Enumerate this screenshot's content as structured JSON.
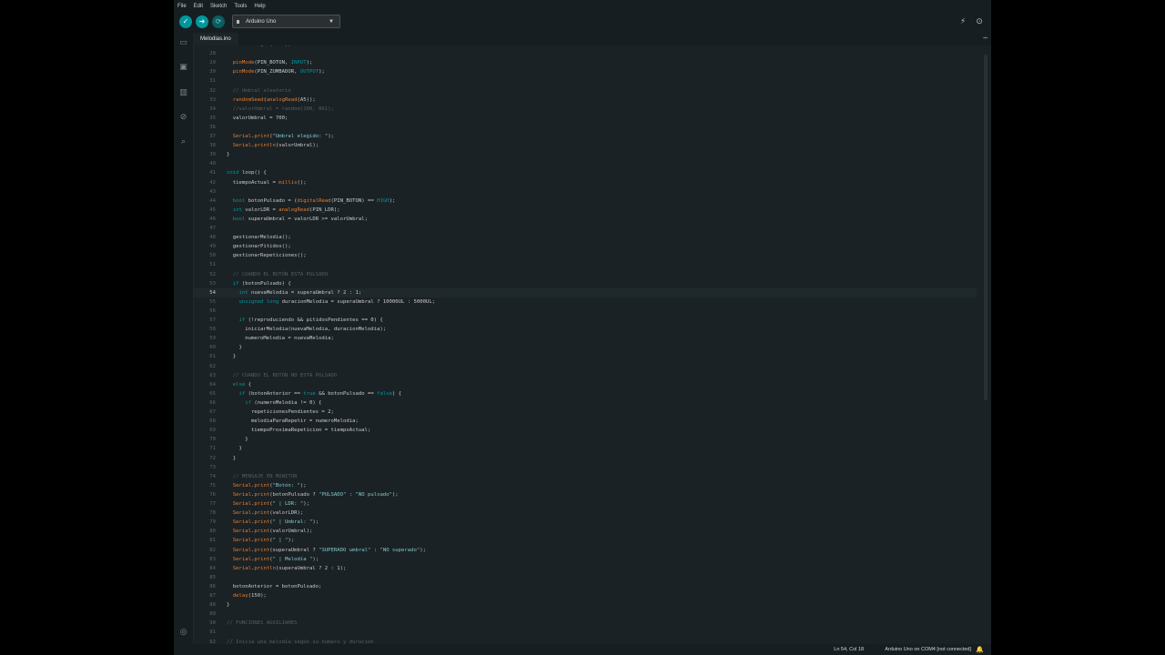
{
  "menu": [
    "File",
    "Edit",
    "Sketch",
    "Tools",
    "Help"
  ],
  "toolbar": {
    "verify_icon": "check-icon",
    "upload_icon": "arrow-right-icon",
    "debug_icon": "debug-icon",
    "board_name": "Arduino Uno",
    "serial_plotter_icon": "plotter-icon",
    "serial_monitor_icon": "magnifier-icon"
  },
  "tab": {
    "filename": "Melodias.ino",
    "more": "⋯"
  },
  "sidebar": [
    "folder-icon",
    "board-icon",
    "library-icon",
    "debug-icon",
    "search-icon",
    "user-icon"
  ],
  "editor": {
    "current_line": 54,
    "lines": [
      {
        "n": "27",
        "t": "  Serial.begin(9600);"
      },
      {
        "n": "28",
        "t": ""
      },
      {
        "n": "29",
        "t": "  pinMode(PIN_BOTON, INPUT);"
      },
      {
        "n": "30",
        "t": "  pinMode(PIN_ZUMBADOR, OUTPUT);"
      },
      {
        "n": "31",
        "t": ""
      },
      {
        "n": "32",
        "t": "  // Umbral aleatorio"
      },
      {
        "n": "33",
        "t": "  randomSeed(analogRead(A5));"
      },
      {
        "n": "34",
        "t": "  //valorUmbral = random(200, 801);"
      },
      {
        "n": "35",
        "t": "  valorUmbral = 700;"
      },
      {
        "n": "36",
        "t": ""
      },
      {
        "n": "37",
        "t": "  Serial.print(\"Umbral elegido: \");"
      },
      {
        "n": "38",
        "t": "  Serial.println(valorUmbral);"
      },
      {
        "n": "39",
        "t": "}"
      },
      {
        "n": "40",
        "t": ""
      },
      {
        "n": "41",
        "t": "void loop() {"
      },
      {
        "n": "42",
        "t": "  tiempoActual = millis();"
      },
      {
        "n": "43",
        "t": ""
      },
      {
        "n": "44",
        "t": "  bool botonPulsado = (digitalRead(PIN_BOTON) == HIGH);"
      },
      {
        "n": "45",
        "t": "  int valorLDR = analogRead(PIN_LDR);"
      },
      {
        "n": "46",
        "t": "  bool superaUmbral = valorLDR >= valorUmbral;"
      },
      {
        "n": "47",
        "t": ""
      },
      {
        "n": "48",
        "t": "  gestionarMelodia();"
      },
      {
        "n": "49",
        "t": "  gestionarPitidos();"
      },
      {
        "n": "50",
        "t": "  gestionarRepeticiones();"
      },
      {
        "n": "51",
        "t": ""
      },
      {
        "n": "52",
        "t": "  // CUANDO EL BOTÓN ESTÁ PULSADO"
      },
      {
        "n": "53",
        "t": "  if (botonPulsado) {"
      },
      {
        "n": "54",
        "t": "    int nuevaMelodia = superaUmbral ? 2 : 1;"
      },
      {
        "n": "55",
        "t": "    unsigned long duracionMelodia = superaUmbral ? 10000UL : 5000UL;"
      },
      {
        "n": "56",
        "t": ""
      },
      {
        "n": "57",
        "t": "    if (!reproduciendo && pitidosPendientes == 0) {"
      },
      {
        "n": "58",
        "t": "      iniciarMelodia(nuevaMelodia, duracionMelodia);"
      },
      {
        "n": "59",
        "t": "      numeroMelodia = nuevaMelodia;"
      },
      {
        "n": "60",
        "t": "    }"
      },
      {
        "n": "61",
        "t": "  }"
      },
      {
        "n": "62",
        "t": ""
      },
      {
        "n": "63",
        "t": "  // CUANDO EL BOTÓN NO ESTÁ PULSADO"
      },
      {
        "n": "64",
        "t": "  else {"
      },
      {
        "n": "65",
        "t": "    if (botonAnterior == true && botonPulsado == false) {"
      },
      {
        "n": "66",
        "t": "      if (numeroMelodia != 0) {"
      },
      {
        "n": "67",
        "t": "        repeticionesPendientes = 2;"
      },
      {
        "n": "68",
        "t": "        melodiaParaRepetir = numeroMelodia;"
      },
      {
        "n": "69",
        "t": "        tiempoProximaRepeticion = tiempoActual;"
      },
      {
        "n": "70",
        "t": "      }"
      },
      {
        "n": "71",
        "t": "    }"
      },
      {
        "n": "72",
        "t": "  }"
      },
      {
        "n": "73",
        "t": ""
      },
      {
        "n": "74",
        "t": "  // MENSAJE EN MONITOR"
      },
      {
        "n": "75",
        "t": "  Serial.print(\"Botón: \");"
      },
      {
        "n": "76",
        "t": "  Serial.print(botonPulsado ? \"PULSADO\" : \"NO pulsado\");"
      },
      {
        "n": "77",
        "t": "  Serial.print(\" | LDR: \");"
      },
      {
        "n": "78",
        "t": "  Serial.print(valorLDR);"
      },
      {
        "n": "79",
        "t": "  Serial.print(\" | Umbral: \");"
      },
      {
        "n": "80",
        "t": "  Serial.print(valorUmbral);"
      },
      {
        "n": "81",
        "t": "  Serial.print(\" | \");"
      },
      {
        "n": "82",
        "t": "  Serial.print(superaUmbral ? \"SUPERADO umbral\" : \"NO superado\");"
      },
      {
        "n": "83",
        "t": "  Serial.print(\" | Melodía \");"
      },
      {
        "n": "84",
        "t": "  Serial.println(superaUmbral ? 2 : 1);"
      },
      {
        "n": "85",
        "t": ""
      },
      {
        "n": "86",
        "t": "  botonAnterior = botonPulsado;"
      },
      {
        "n": "87",
        "t": "  delay(150);"
      },
      {
        "n": "88",
        "t": "}"
      },
      {
        "n": "89",
        "t": ""
      },
      {
        "n": "90",
        "t": "// FUNCIONES AUXILIARES"
      },
      {
        "n": "91",
        "t": ""
      },
      {
        "n": "92",
        "t": "// Inicia una melodía según su número y duración"
      }
    ]
  },
  "status": {
    "position": "Ln 54, Col 18",
    "port": "Arduino Uno on COM4 [not connected]",
    "bell_icon": "bell-icon"
  },
  "colors": {
    "accent": "#00979c",
    "background": "#1b2225",
    "keyword": "#00979d",
    "function": "#e97d2b"
  }
}
